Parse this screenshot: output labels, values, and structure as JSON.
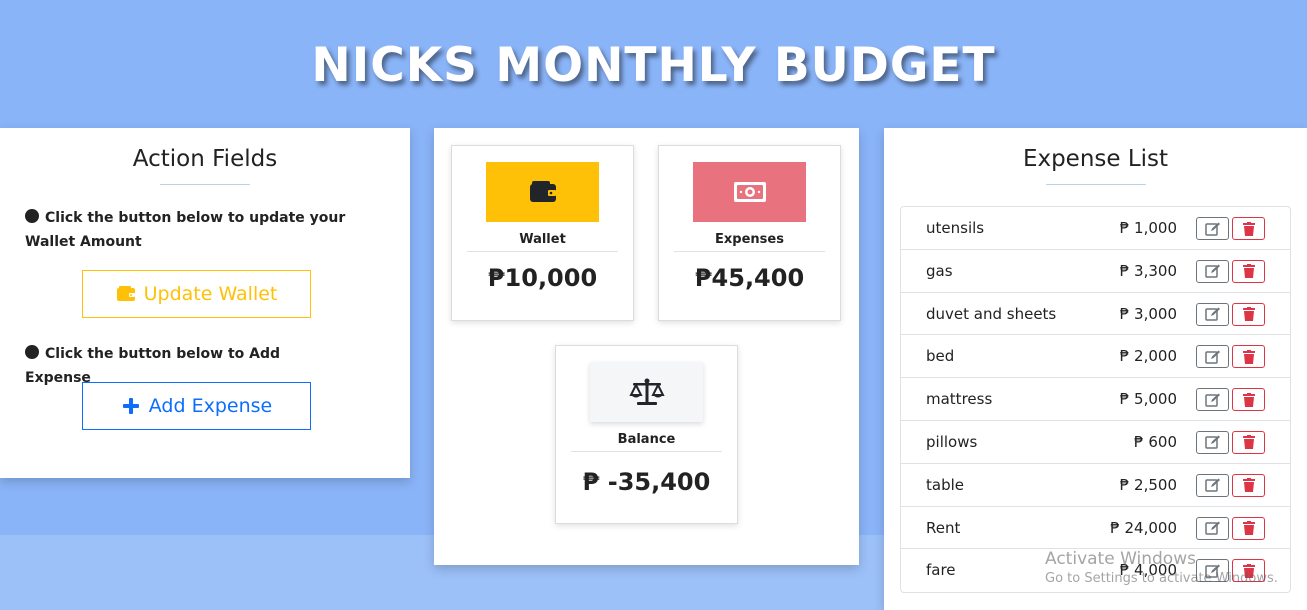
{
  "header": {
    "title": "NICKS MONTHLY BUDGET"
  },
  "action_fields": {
    "title": "Action Fields",
    "wallet_instruction": "Click the button below to update your Wallet Amount",
    "update_wallet_label": "Update Wallet",
    "expense_instruction": "Click the button below to Add Expense",
    "add_expense_label": "Add Expense"
  },
  "summary": {
    "wallet": {
      "label": "Wallet",
      "value": "₱10,000",
      "icon": "wallet-icon"
    },
    "expenses": {
      "label": "Expenses",
      "value": "₱45,400",
      "icon": "money-bill-icon"
    },
    "balance": {
      "label": "Balance",
      "value": "₱ -35,400",
      "icon": "balance-scale-icon"
    }
  },
  "expense_list": {
    "title": "Expense List",
    "items": [
      {
        "name": "utensils",
        "amount": "₱ 1,000"
      },
      {
        "name": "gas",
        "amount": "₱ 3,300"
      },
      {
        "name": "duvet and sheets",
        "amount": "₱ 3,000"
      },
      {
        "name": "bed",
        "amount": "₱ 2,000"
      },
      {
        "name": "mattress",
        "amount": "₱ 5,000"
      },
      {
        "name": "pillows",
        "amount": "₱ 600"
      },
      {
        "name": "table",
        "amount": "₱ 2,500"
      },
      {
        "name": "Rent",
        "amount": "₱ 24,000"
      },
      {
        "name": "fare",
        "amount": "₱ 4,000"
      }
    ]
  },
  "watermark": {
    "title": "Activate Windows",
    "subtitle": "Go to Settings to activate Windows."
  },
  "colors": {
    "background": "#8ab4f8",
    "wallet": "#ffc107",
    "expenses": "#e8727e",
    "primary": "#0d6efd",
    "danger": "#dc3545"
  }
}
